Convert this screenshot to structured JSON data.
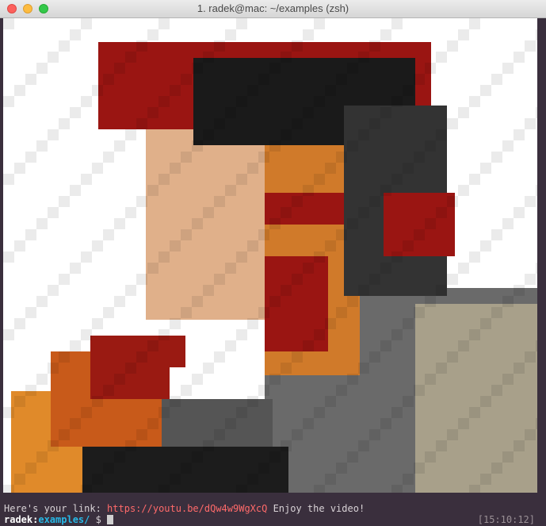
{
  "window": {
    "title": "1. radek@mac: ~/examples (zsh)"
  },
  "terminal": {
    "message_prefix": "Here's your link: ",
    "link": "https://youtu.be/dQw4w9WgXcQ",
    "message_suffix": " Enjoy the video!",
    "prompt_user": "radek",
    "prompt_sep": ":",
    "prompt_dir": "examples/",
    "prompt_symbol": " $ ",
    "clock": "[15:10:12]"
  },
  "colors": {
    "background": "#3a2f3d",
    "link": "#ff6a6a",
    "directory": "#27b8e6"
  },
  "image": {
    "description_icon": "pixelated-portrait-image"
  }
}
